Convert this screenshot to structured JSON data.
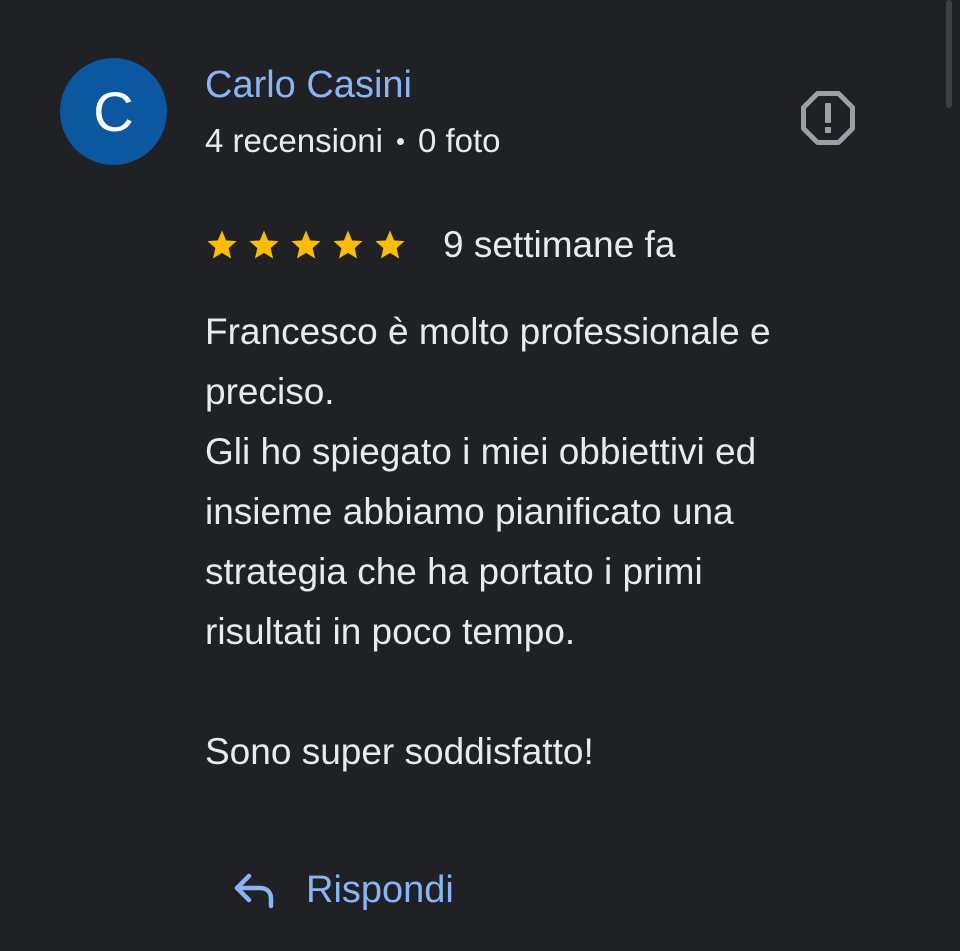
{
  "author": {
    "initial": "C",
    "name": "Carlo Casini",
    "reviews_count": "4 recensioni",
    "photos_count": "0 foto",
    "avatar_color": "#0b57a0"
  },
  "review": {
    "rating": 5,
    "max_rating": 5,
    "time": "9 settimane fa",
    "text": "Francesco è molto professionale e\npreciso.\nGli ho spiegato i miei obbiettivi ed\ninsieme abbiamo pianificato una\nstrategia che ha portato i primi\nrisultati in poco tempo.\n\nSono super soddisfatto!"
  },
  "actions": {
    "reply_label": "Rispondi",
    "report_icon": "report-octagon-icon",
    "reply_icon": "reply-arrow-icon"
  },
  "colors": {
    "background": "#202124",
    "link": "#8ab4f8",
    "star": "#fbbc04",
    "text": "#e8eaed",
    "icon_gray": "#9aa0a6"
  }
}
